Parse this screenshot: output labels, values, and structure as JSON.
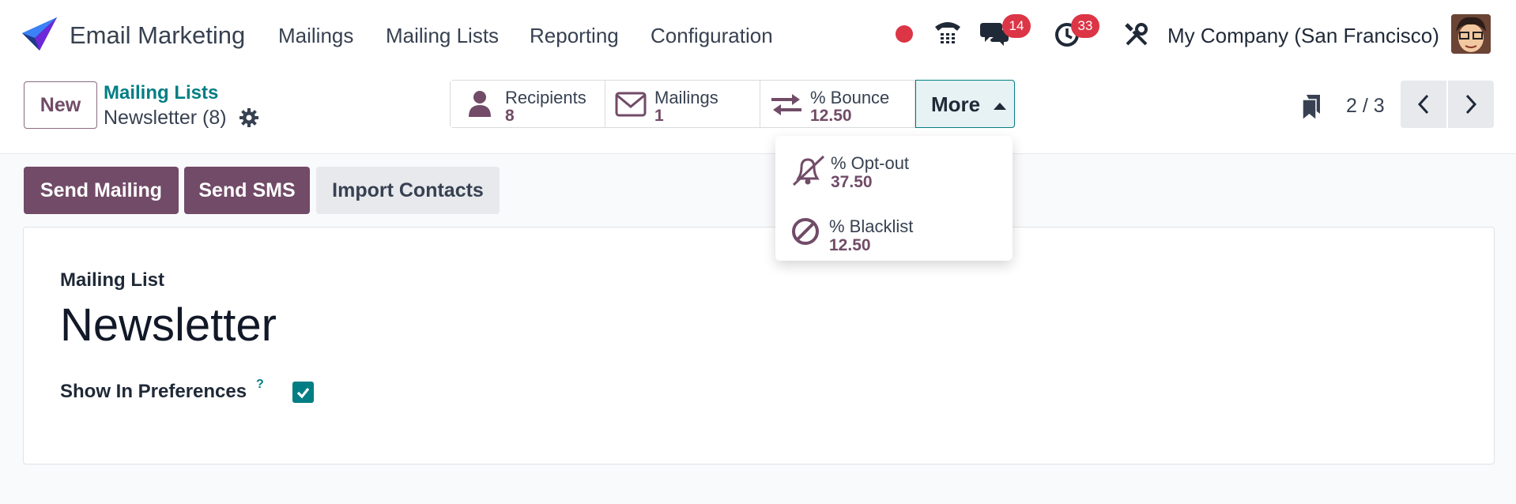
{
  "app": {
    "name": "Email Marketing"
  },
  "nav": {
    "menu": [
      "Mailings",
      "Mailing Lists",
      "Reporting",
      "Configuration"
    ],
    "messages_count": "14",
    "activities_count": "33",
    "company": "My Company (San Francisco)"
  },
  "control_panel": {
    "new_label": "New",
    "breadcrumb_parent": "Mailing Lists",
    "breadcrumb_current": "Newsletter (8)",
    "pager": "2 / 3"
  },
  "smart_buttons": [
    {
      "label": "Recipients",
      "value": "8",
      "icon": "user-icon"
    },
    {
      "label": "Mailings",
      "value": "1",
      "icon": "envelope-icon"
    },
    {
      "label": "% Bounce",
      "value": "12.50",
      "icon": "exchange-icon"
    }
  ],
  "more_label": "More",
  "dropdown": [
    {
      "label": "% Opt-out",
      "value": "37.50",
      "icon": "bell-slash-icon"
    },
    {
      "label": "% Blacklist",
      "value": "12.50",
      "icon": "ban-icon"
    }
  ],
  "actions": [
    "Send Mailing",
    "Send SMS",
    "Import Contacts"
  ],
  "form": {
    "field_label": "Mailing List",
    "name": "Newsletter",
    "pref_label": "Show In Preferences",
    "pref_help": "?",
    "pref_checked": true
  },
  "colors": {
    "brand": "#714b67",
    "accent": "#017e84",
    "badge": "#dc3545"
  }
}
